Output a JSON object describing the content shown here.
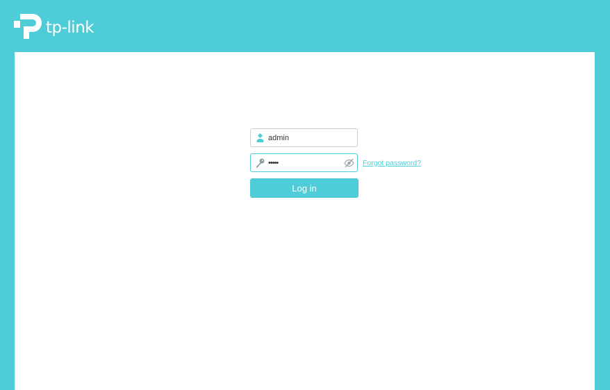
{
  "brand": {
    "name": "tp-link",
    "logo_icon": "tp-link-logo-icon"
  },
  "login": {
    "username_value": "admin",
    "username_icon": "user-icon",
    "password_value": "•••••",
    "password_icon": "key-icon",
    "toggle_visibility_icon": "eye-slash-icon",
    "forgot_password_label": "Forgot password?",
    "submit_label": "Log in"
  },
  "colors": {
    "accent": "#4ecdd8",
    "panel": "#ffffff",
    "border": "#c8cfd3"
  }
}
